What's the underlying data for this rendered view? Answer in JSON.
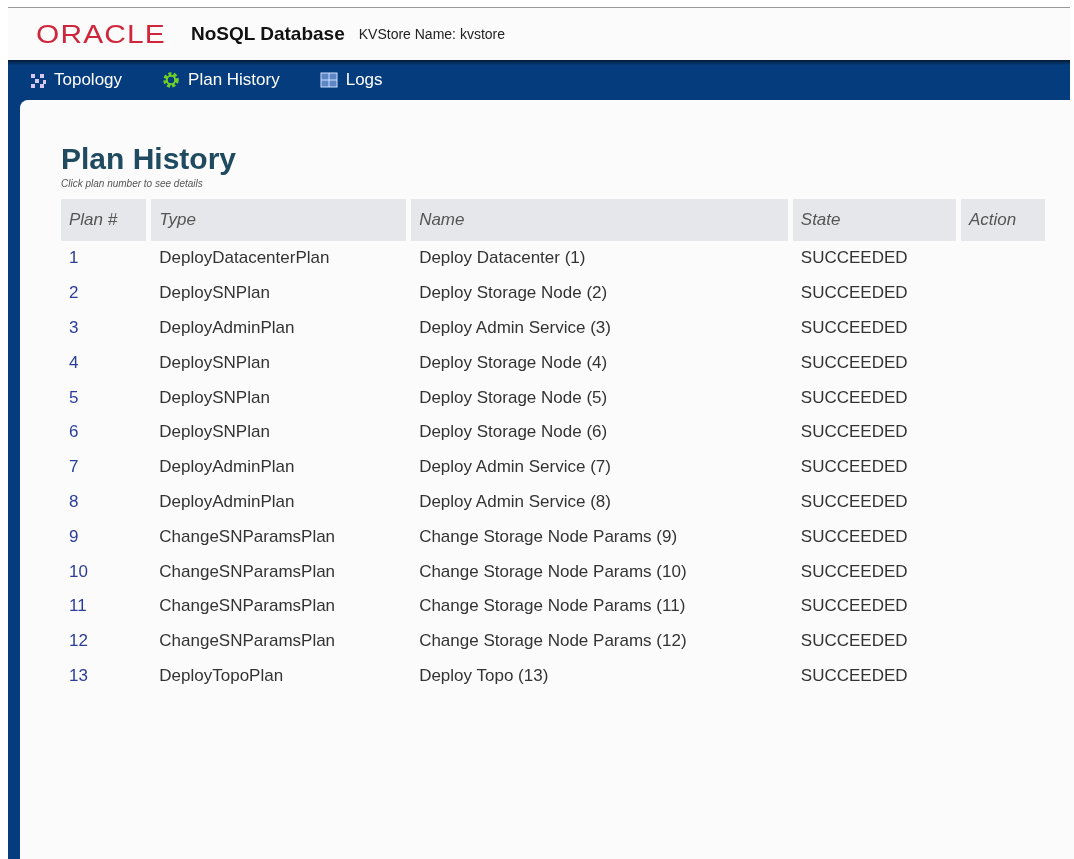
{
  "header": {
    "logo": "ORACLE",
    "product": "NoSQL Database",
    "store": "KVStore Name: kvstore"
  },
  "nav": [
    {
      "label": "Topology",
      "kind": "topology"
    },
    {
      "label": "Plan History",
      "kind": "plans"
    },
    {
      "label": "Logs",
      "kind": "logs"
    }
  ],
  "page": {
    "title": "Plan History",
    "hint": "Click plan number to see details"
  },
  "table": {
    "columns": [
      "Plan #",
      "Type",
      "Name",
      "State",
      "Action"
    ],
    "rows": [
      {
        "plan": "1",
        "type": "DeployDatacenterPlan",
        "name": "Deploy Datacenter (1)",
        "state": "SUCCEEDED"
      },
      {
        "plan": "2",
        "type": "DeploySNPlan",
        "name": "Deploy Storage Node (2)",
        "state": "SUCCEEDED"
      },
      {
        "plan": "3",
        "type": "DeployAdminPlan",
        "name": "Deploy Admin Service (3)",
        "state": "SUCCEEDED"
      },
      {
        "plan": "4",
        "type": "DeploySNPlan",
        "name": "Deploy Storage Node (4)",
        "state": "SUCCEEDED"
      },
      {
        "plan": "5",
        "type": "DeploySNPlan",
        "name": "Deploy Storage Node (5)",
        "state": "SUCCEEDED"
      },
      {
        "plan": "6",
        "type": "DeploySNPlan",
        "name": "Deploy Storage Node (6)",
        "state": "SUCCEEDED"
      },
      {
        "plan": "7",
        "type": "DeployAdminPlan",
        "name": "Deploy Admin Service (7)",
        "state": "SUCCEEDED"
      },
      {
        "plan": "8",
        "type": "DeployAdminPlan",
        "name": "Deploy Admin Service (8)",
        "state": "SUCCEEDED"
      },
      {
        "plan": "9",
        "type": "ChangeSNParamsPlan",
        "name": "Change Storage Node Params (9)",
        "state": "SUCCEEDED"
      },
      {
        "plan": "10",
        "type": "ChangeSNParamsPlan",
        "name": "Change Storage Node Params (10)",
        "state": "SUCCEEDED"
      },
      {
        "plan": "11",
        "type": "ChangeSNParamsPlan",
        "name": "Change Storage Node Params (11)",
        "state": "SUCCEEDED"
      },
      {
        "plan": "12",
        "type": "ChangeSNParamsPlan",
        "name": "Change Storage Node Params (12)",
        "state": "SUCCEEDED"
      },
      {
        "plan": "13",
        "type": "DeployTopoPlan",
        "name": "Deploy Topo (13)",
        "state": "SUCCEEDED"
      }
    ]
  }
}
